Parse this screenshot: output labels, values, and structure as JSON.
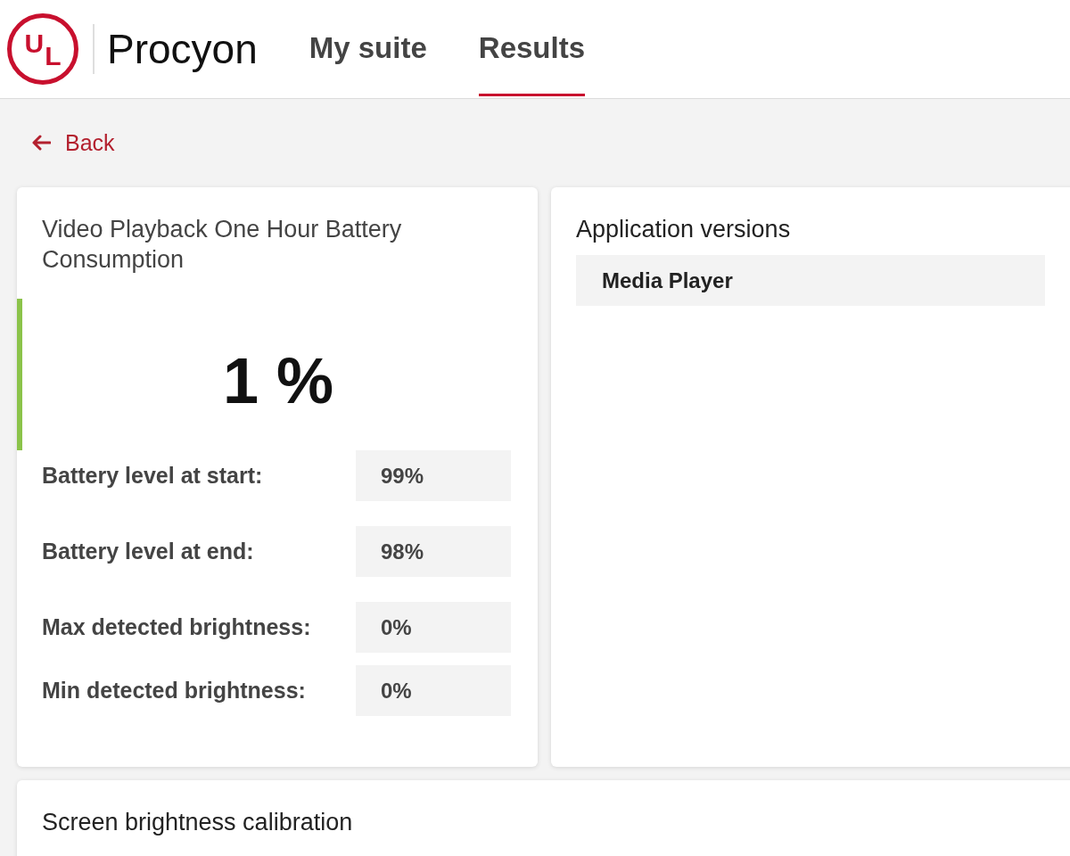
{
  "header": {
    "logo": {
      "letters": [
        "U",
        "L"
      ]
    },
    "brand": "Procyon",
    "nav": [
      {
        "label": "My suite",
        "selected": false
      },
      {
        "label": "Results",
        "selected": true
      }
    ]
  },
  "back_link": {
    "label": "Back"
  },
  "result_card": {
    "title": "Video Playback One Hour Battery Consumption",
    "score": "1 %",
    "rows": [
      {
        "label": "Battery level at start:",
        "value": "99%"
      },
      {
        "label": "Battery level at end:",
        "value": "98%"
      },
      {
        "label": "Max detected brightness:",
        "value": "0%"
      },
      {
        "label": "Min detected brightness:",
        "value": "0%"
      }
    ]
  },
  "versions_card": {
    "title": "Application versions",
    "items": [
      "Media Player"
    ]
  },
  "calibration_card": {
    "title": "Screen brightness calibration"
  }
}
